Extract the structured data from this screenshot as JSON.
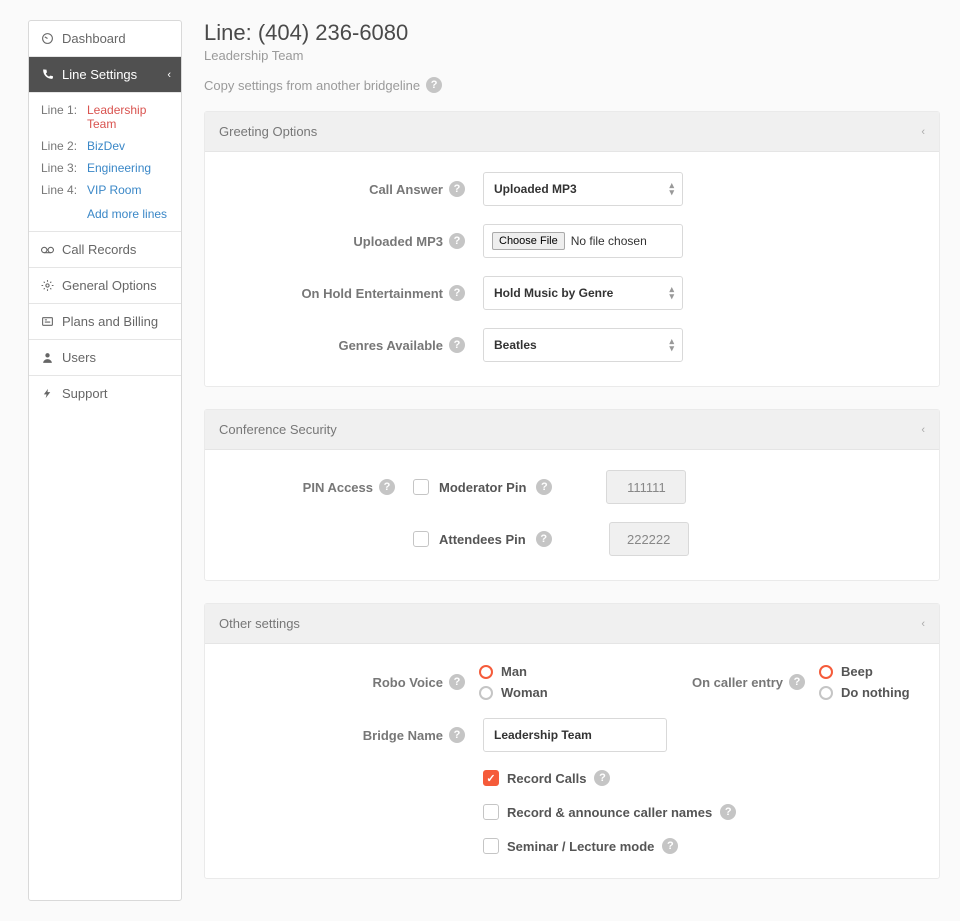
{
  "sidebar": {
    "dashboard": "Dashboard",
    "line_settings": "Line Settings",
    "call_records": "Call Records",
    "general_options": "General Options",
    "plans_billing": "Plans and Billing",
    "users": "Users",
    "support": "Support",
    "lines": [
      {
        "idx": "Line 1:",
        "name": "Leadership Team",
        "active": true
      },
      {
        "idx": "Line 2:",
        "name": "BizDev",
        "active": false
      },
      {
        "idx": "Line 3:",
        "name": "Engineering",
        "active": false
      },
      {
        "idx": "Line 4:",
        "name": "VIP Room",
        "active": false
      }
    ],
    "add_more": "Add more lines"
  },
  "header": {
    "title": "Line: (404) 236-6080",
    "subtitle": "Leadership Team",
    "copy_settings": "Copy settings from another bridgeline"
  },
  "greeting": {
    "title": "Greeting Options",
    "call_answer_label": "Call Answer",
    "call_answer_value": "Uploaded MP3",
    "uploaded_mp3_label": "Uploaded MP3",
    "choose_file": "Choose File",
    "no_file": "No file chosen",
    "on_hold_label": "On Hold Entertainment",
    "on_hold_value": "Hold Music by Genre",
    "genres_label": "Genres Available",
    "genres_value": "Beatles"
  },
  "security": {
    "title": "Conference Security",
    "pin_access_label": "PIN Access",
    "mod_pin_label": "Moderator Pin",
    "mod_pin_value": "111111",
    "att_pin_label": "Attendees Pin",
    "att_pin_value": "222222"
  },
  "other": {
    "title": "Other settings",
    "robo_label": "Robo Voice",
    "robo_man": "Man",
    "robo_woman": "Woman",
    "caller_entry_label": "On caller entry",
    "beep": "Beep",
    "do_nothing": "Do nothing",
    "bridge_label": "Bridge Name",
    "bridge_value": "Leadership Team",
    "record_calls": "Record Calls",
    "announce": "Record & announce caller names",
    "seminar": "Seminar / Lecture mode"
  }
}
